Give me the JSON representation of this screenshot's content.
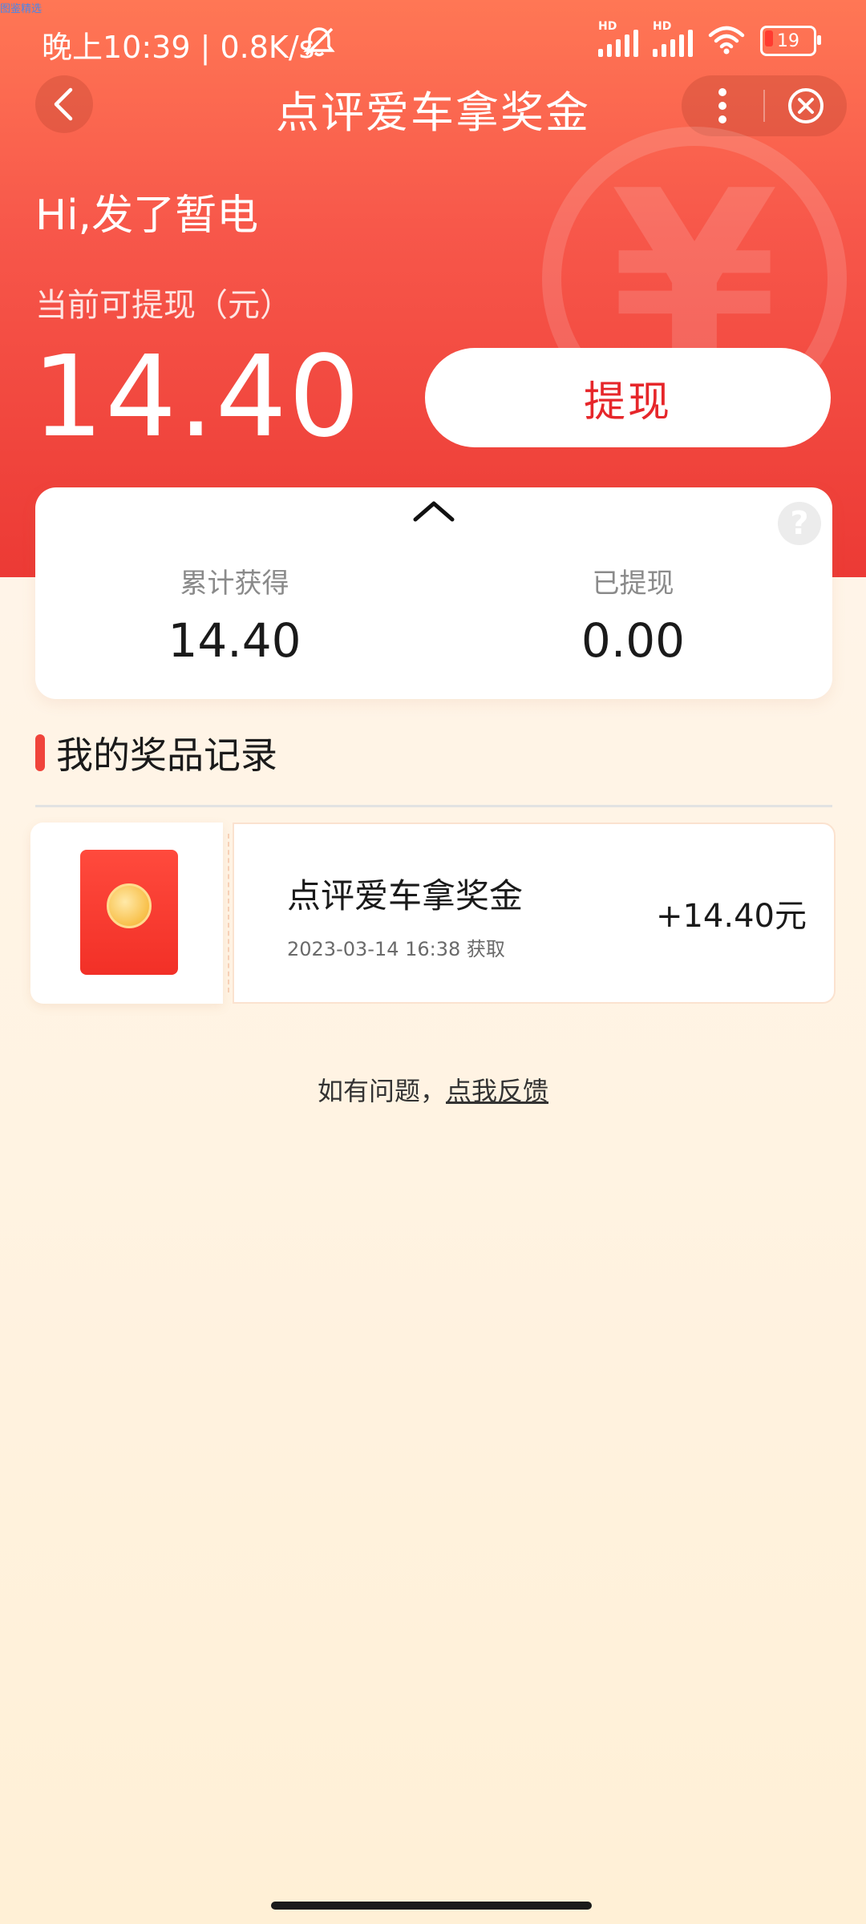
{
  "top_tiny_text": "图鉴精选",
  "status_bar": {
    "time_speed": "晚上10:39 | 0.8K/s",
    "sim1_hd": "HD",
    "sim2_hd": "HD",
    "battery": "19"
  },
  "nav": {
    "title": "点评爱车拿奖金"
  },
  "watermark_symbol": "¥",
  "greeting": "Hi,发了暂电",
  "balance": {
    "label": "当前可提现（元）",
    "amount": "14.40",
    "withdraw_button": "提现"
  },
  "stats": {
    "total_label": "累计获得",
    "total_value": "14.40",
    "withdrawn_label": "已提现",
    "withdrawn_value": "0.00",
    "help_symbol": "?"
  },
  "records_section": {
    "title": "我的奖品记录",
    "items": [
      {
        "title": "点评爱车拿奖金",
        "time": "2023-03-14 16:38 获取",
        "amount": "+14.40元"
      }
    ]
  },
  "feedback": {
    "prefix": "如有问题，",
    "link": "点我反馈"
  },
  "colors": {
    "header_top": "#ff7755",
    "header_bottom": "#ec3a35",
    "accent_red": "#e6262a",
    "background": "#fff6ee"
  }
}
